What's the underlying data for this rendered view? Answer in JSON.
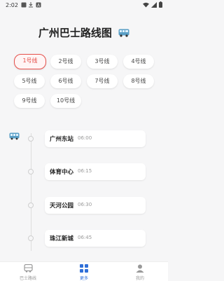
{
  "status_bar": {
    "time": "2:02"
  },
  "title": "广州巴士路线图",
  "lines": [
    {
      "label": "1号线",
      "active": true
    },
    {
      "label": "2号线"
    },
    {
      "label": "3号线"
    },
    {
      "label": "4号线"
    },
    {
      "label": "5号线"
    },
    {
      "label": "6号线"
    },
    {
      "label": "7号线"
    },
    {
      "label": "8号线"
    },
    {
      "label": "9号线"
    },
    {
      "label": "10号线"
    }
  ],
  "stops": [
    {
      "name": "广州东站",
      "time": "06:00"
    },
    {
      "name": "体育中心",
      "time": "06:15"
    },
    {
      "name": "天河公园",
      "time": "06:30"
    },
    {
      "name": "珠江新城",
      "time": "06:45"
    }
  ],
  "bottom_nav": [
    {
      "label": "巴士路线",
      "icon": "bus-icon"
    },
    {
      "label": "更多",
      "icon": "grid-icon",
      "active": true
    },
    {
      "label": "我的",
      "icon": "person-icon"
    }
  ],
  "colors": {
    "accent_red": "#e34c47",
    "active_blue": "#2f6fd8",
    "bus_teal": "#5a9fc6"
  }
}
